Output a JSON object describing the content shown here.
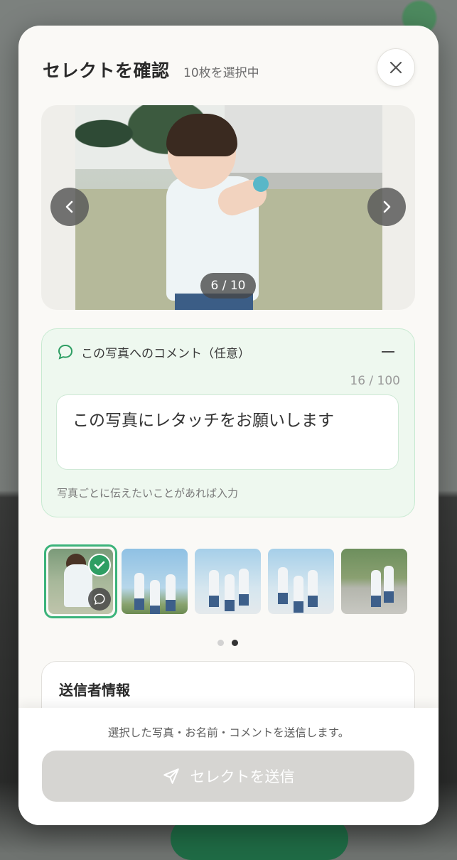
{
  "modal": {
    "title": "セレクトを確認",
    "subtitle": "10枚を選択中",
    "close_icon": "close-icon"
  },
  "viewer": {
    "counter": "6 / 10",
    "prev_icon": "chevron-left-icon",
    "next_icon": "chevron-right-icon"
  },
  "comment": {
    "title": "この写真へのコメント（任意）",
    "char_count": "16 / 100",
    "text": "この写真にレタッチをお願いします",
    "hint": "写真ごとに伝えたいことがあれば入力",
    "icon": "speech-bubble-icon",
    "collapse_icon": "minus-icon"
  },
  "thumbnails": [
    {
      "selected": true,
      "has_comment": true
    },
    {
      "selected": false,
      "has_comment": false
    },
    {
      "selected": false,
      "has_comment": false
    },
    {
      "selected": false,
      "has_comment": false
    },
    {
      "selected": false,
      "has_comment": false
    }
  ],
  "pagination": {
    "pages": 2,
    "current": 2
  },
  "sender": {
    "title": "送信者情報"
  },
  "footer": {
    "note": "選択した写真・お名前・コメントを送信します。",
    "submit_label": "セレクトを送信",
    "submit_icon": "send-icon"
  },
  "colors": {
    "accent": "#3bb37a",
    "comment_bg": "#eef8ef",
    "disabled_button": "#d6d5d2"
  }
}
